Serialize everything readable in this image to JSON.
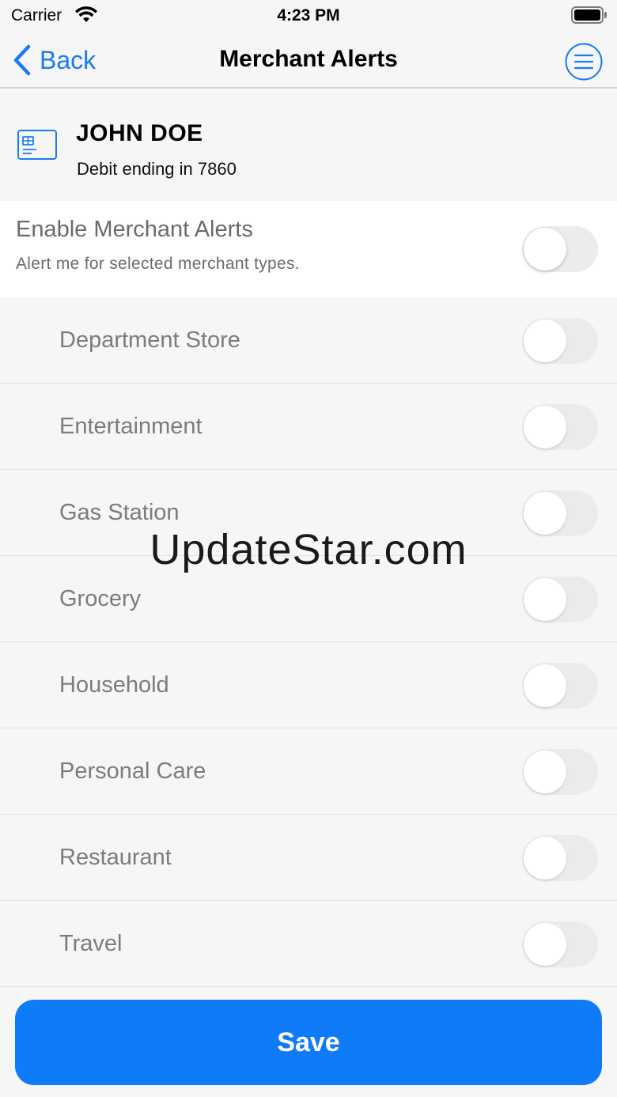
{
  "status_bar": {
    "carrier": "Carrier",
    "time": "4:23 PM"
  },
  "nav": {
    "back_label": "Back",
    "title": "Merchant Alerts"
  },
  "account": {
    "name": "JOHN DOE",
    "subtitle": "Debit ending in 7860"
  },
  "enable": {
    "title": "Enable Merchant Alerts",
    "subtitle": "Alert me for selected merchant types.",
    "enabled": false
  },
  "merchants": [
    {
      "label": "Department Store",
      "enabled": false
    },
    {
      "label": "Entertainment",
      "enabled": false
    },
    {
      "label": "Gas Station",
      "enabled": false
    },
    {
      "label": "Grocery",
      "enabled": false
    },
    {
      "label": "Household",
      "enabled": false
    },
    {
      "label": "Personal Care",
      "enabled": false
    },
    {
      "label": "Restaurant",
      "enabled": false
    },
    {
      "label": "Travel",
      "enabled": false
    }
  ],
  "watermark": "UpdateStar.com",
  "save_label": "Save",
  "colors": {
    "accent": "#0f7bf7",
    "background": "#f6f6f7"
  }
}
